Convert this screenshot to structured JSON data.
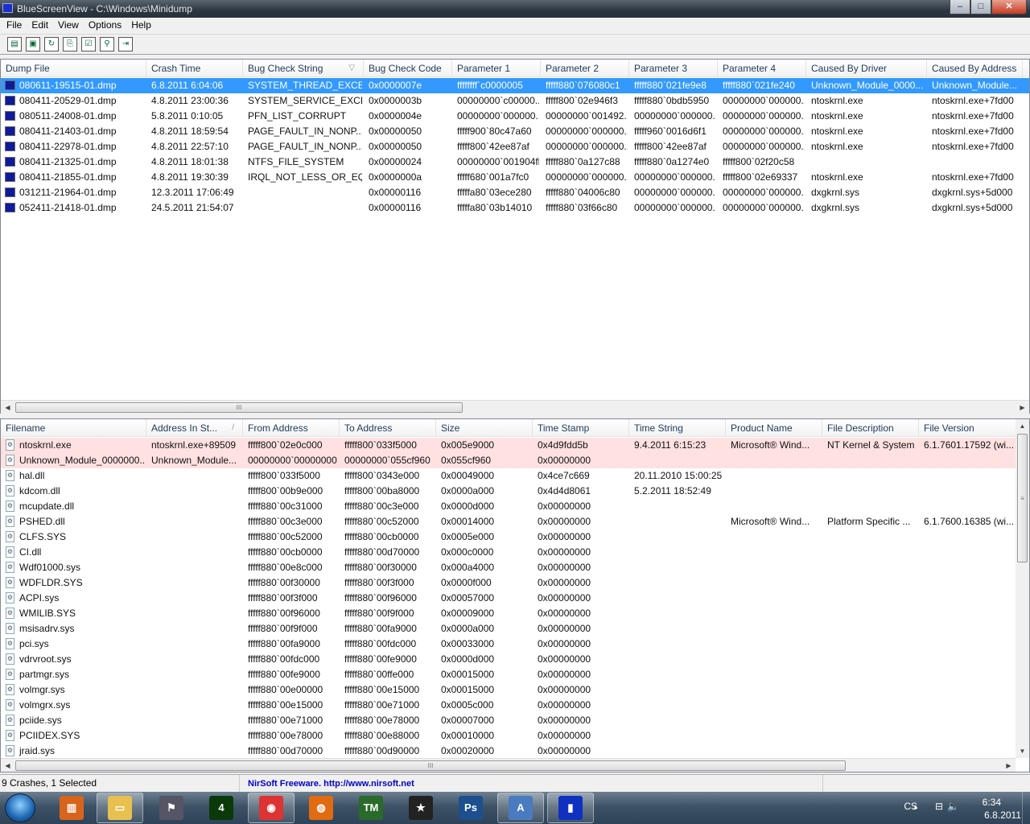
{
  "window": {
    "title": "BlueScreenView  -  C:\\Windows\\Minidump",
    "min": "–",
    "max": "□",
    "close": "✕"
  },
  "menu": [
    "File",
    "Edit",
    "View",
    "Options",
    "Help"
  ],
  "toolbar": [
    {
      "name": "html-report-icon",
      "g": "▤"
    },
    {
      "name": "save-icon",
      "g": "▣"
    },
    {
      "name": "refresh-icon",
      "g": "↻"
    },
    {
      "name": "copy-icon",
      "g": "⎘"
    },
    {
      "name": "properties-icon",
      "g": "☑"
    },
    {
      "name": "find-icon",
      "g": "⚲"
    },
    {
      "name": "exit-icon",
      "g": "⇥"
    }
  ],
  "crashes": {
    "columns": [
      "Dump File",
      "Crash Time",
      "Bug Check String",
      "Bug Check Code",
      "Parameter 1",
      "Parameter 2",
      "Parameter 3",
      "Parameter 4",
      "Caused By Driver",
      "Caused By Address"
    ],
    "sort_indicator": "▽",
    "rows": [
      [
        "080611-19515-01.dmp",
        "6.8.2011 6:04:06",
        "SYSTEM_THREAD_EXCE...",
        "0x0000007e",
        "ffffffff`c0000005",
        "fffff880`076080c1",
        "fffff880`021fe9e8",
        "fffff880`021fe240",
        "Unknown_Module_0000...",
        "Unknown_Module..."
      ],
      [
        "080411-20529-01.dmp",
        "4.8.2011 23:00:36",
        "SYSTEM_SERVICE_EXCE...",
        "0x0000003b",
        "00000000`c00000...",
        "fffff800`02e946f3",
        "fffff880`0bdb5950",
        "00000000`000000...",
        "ntoskrnl.exe",
        "ntoskrnl.exe+7fd00"
      ],
      [
        "080511-24008-01.dmp",
        "5.8.2011 0:10:05",
        "PFN_LIST_CORRUPT",
        "0x0000004e",
        "00000000`000000...",
        "00000000`001492...",
        "00000000`000000...",
        "00000000`000000...",
        "ntoskrnl.exe",
        "ntoskrnl.exe+7fd00"
      ],
      [
        "080411-21403-01.dmp",
        "4.8.2011 18:59:54",
        "PAGE_FAULT_IN_NONP...",
        "0x00000050",
        "fffff900`80c47a60",
        "00000000`000000...",
        "fffff960`0016d6f1",
        "00000000`000000...",
        "ntoskrnl.exe",
        "ntoskrnl.exe+7fd00"
      ],
      [
        "080411-22978-01.dmp",
        "4.8.2011 22:57:10",
        "PAGE_FAULT_IN_NONP...",
        "0x00000050",
        "fffff800`42ee87af",
        "00000000`000000...",
        "fffff800`42ee87af",
        "00000000`000000...",
        "ntoskrnl.exe",
        "ntoskrnl.exe+7fd00"
      ],
      [
        "080411-21325-01.dmp",
        "4.8.2011 18:01:38",
        "NTFS_FILE_SYSTEM",
        "0x00000024",
        "00000000`001904fb",
        "fffff880`0a127c88",
        "fffff880`0a1274e0",
        "fffff800`02f20c58",
        "",
        ""
      ],
      [
        "080411-21855-01.dmp",
        "4.8.2011 19:30:39",
        "IRQL_NOT_LESS_OR_EQ...",
        "0x0000000a",
        "fffff680`001a7fc0",
        "00000000`000000...",
        "00000000`000000...",
        "fffff800`02e69337",
        "ntoskrnl.exe",
        "ntoskrnl.exe+7fd00"
      ],
      [
        "031211-21964-01.dmp",
        "12.3.2011 17:06:49",
        "",
        "0x00000116",
        "fffffa80`03ece280",
        "fffff880`04006c80",
        "00000000`000000...",
        "00000000`000000...",
        "dxgkrnl.sys",
        "dxgkrnl.sys+5d000"
      ],
      [
        "052411-21418-01.dmp",
        "24.5.2011 21:54:07",
        "",
        "0x00000116",
        "fffffa80`03b14010",
        "fffff880`03f66c80",
        "00000000`000000...",
        "00000000`000000...",
        "dxgkrnl.sys",
        "dxgkrnl.sys+5d000"
      ]
    ],
    "selected_index": 0
  },
  "modules": {
    "columns": [
      "Filename",
      "Address In St...",
      "From Address",
      "To Address",
      "Size",
      "Time Stamp",
      "Time String",
      "Product Name",
      "File Description",
      "File Version"
    ],
    "sort_indicator": "/",
    "highlighted": [
      0,
      1
    ],
    "rows": [
      [
        "ntoskrnl.exe",
        "ntoskrnl.exe+89509",
        "fffff800`02e0c000",
        "fffff800`033f5000",
        "0x005e9000",
        "0x4d9fdd5b",
        "9.4.2011 6:15:23",
        "Microsoft® Wind...",
        "NT Kernel & System",
        "6.1.7601.17592 (wi..."
      ],
      [
        "Unknown_Module_0000000...",
        "Unknown_Module...",
        "00000000`00000000",
        "00000000`055cf960",
        "0x055cf960",
        "0x00000000",
        "",
        "",
        "",
        ""
      ],
      [
        "hal.dll",
        "",
        "fffff800`033f5000",
        "fffff800`0343e000",
        "0x00049000",
        "0x4ce7c669",
        "20.11.2010 15:00:25",
        "",
        "",
        ""
      ],
      [
        "kdcom.dll",
        "",
        "fffff800`00b9e000",
        "fffff800`00ba8000",
        "0x0000a000",
        "0x4d4d8061",
        "5.2.2011 18:52:49",
        "",
        "",
        ""
      ],
      [
        "mcupdate.dll",
        "",
        "fffff880`00c31000",
        "fffff880`00c3e000",
        "0x0000d000",
        "0x00000000",
        "",
        "",
        "",
        ""
      ],
      [
        "PSHED.dll",
        "",
        "fffff880`00c3e000",
        "fffff880`00c52000",
        "0x00014000",
        "0x00000000",
        "",
        "Microsoft® Wind...",
        "Platform Specific ...",
        "6.1.7600.16385 (wi..."
      ],
      [
        "CLFS.SYS",
        "",
        "fffff880`00c52000",
        "fffff880`00cb0000",
        "0x0005e000",
        "0x00000000",
        "",
        "",
        "",
        ""
      ],
      [
        "CI.dll",
        "",
        "fffff880`00cb0000",
        "fffff880`00d70000",
        "0x000c0000",
        "0x00000000",
        "",
        "",
        "",
        ""
      ],
      [
        "Wdf01000.sys",
        "",
        "fffff880`00e8c000",
        "fffff880`00f30000",
        "0x000a4000",
        "0x00000000",
        "",
        "",
        "",
        ""
      ],
      [
        "WDFLDR.SYS",
        "",
        "fffff880`00f30000",
        "fffff880`00f3f000",
        "0x0000f000",
        "0x00000000",
        "",
        "",
        "",
        ""
      ],
      [
        "ACPI.sys",
        "",
        "fffff880`00f3f000",
        "fffff880`00f96000",
        "0x00057000",
        "0x00000000",
        "",
        "",
        "",
        ""
      ],
      [
        "WMILIB.SYS",
        "",
        "fffff880`00f96000",
        "fffff880`00f9f000",
        "0x00009000",
        "0x00000000",
        "",
        "",
        "",
        ""
      ],
      [
        "msisadrv.sys",
        "",
        "fffff880`00f9f000",
        "fffff880`00fa9000",
        "0x0000a000",
        "0x00000000",
        "",
        "",
        "",
        ""
      ],
      [
        "pci.sys",
        "",
        "fffff880`00fa9000",
        "fffff880`00fdc000",
        "0x00033000",
        "0x00000000",
        "",
        "",
        "",
        ""
      ],
      [
        "vdrvroot.sys",
        "",
        "fffff880`00fdc000",
        "fffff880`00fe9000",
        "0x0000d000",
        "0x00000000",
        "",
        "",
        "",
        ""
      ],
      [
        "partmgr.sys",
        "",
        "fffff880`00fe9000",
        "fffff880`00ffe000",
        "0x00015000",
        "0x00000000",
        "",
        "",
        "",
        ""
      ],
      [
        "volmgr.sys",
        "",
        "fffff880`00e00000",
        "fffff880`00e15000",
        "0x00015000",
        "0x00000000",
        "",
        "",
        "",
        ""
      ],
      [
        "volmgrx.sys",
        "",
        "fffff880`00e15000",
        "fffff880`00e71000",
        "0x0005c000",
        "0x00000000",
        "",
        "",
        "",
        ""
      ],
      [
        "pciide.sys",
        "",
        "fffff880`00e71000",
        "fffff880`00e78000",
        "0x00007000",
        "0x00000000",
        "",
        "",
        "",
        ""
      ],
      [
        "PCIIDEX.SYS",
        "",
        "fffff880`00e78000",
        "fffff880`00e88000",
        "0x00010000",
        "0x00000000",
        "",
        "",
        "",
        ""
      ],
      [
        "jraid.sys",
        "",
        "fffff880`00d70000",
        "fffff880`00d90000",
        "0x00020000",
        "0x00000000",
        "",
        "",
        "",
        ""
      ]
    ]
  },
  "status": {
    "count": "9 Crashes, 1 Selected",
    "link_prefix": "NirSoft Freeware.  ",
    "link": "http://www.nirsoft.net"
  },
  "taskbar": {
    "apps": [
      {
        "name": "winamp",
        "g": "▥",
        "c": "#d8641c"
      },
      {
        "name": "explorer",
        "g": "▭",
        "c": "#e8c050"
      },
      {
        "name": "counter-strike",
        "g": "⚑",
        "c": "#556"
      },
      {
        "name": "app-green",
        "g": "4",
        "c": "#0a3a0a"
      },
      {
        "name": "chrome",
        "g": "◉",
        "c": "#d33"
      },
      {
        "name": "firefox",
        "g": "◍",
        "c": "#e26a10"
      },
      {
        "name": "tm",
        "g": "TM",
        "c": "#2a6a2a"
      },
      {
        "name": "star-2",
        "g": "★",
        "c": "#222"
      },
      {
        "name": "photoshop",
        "g": "Ps",
        "c": "#1d4f8f"
      },
      {
        "name": "wordpad",
        "g": "A",
        "c": "#4a7ac0"
      },
      {
        "name": "bluescreenview",
        "g": "▮",
        "c": "#1030c0"
      }
    ],
    "language": "CS",
    "time": "6:34",
    "date": "6.8.2011"
  }
}
